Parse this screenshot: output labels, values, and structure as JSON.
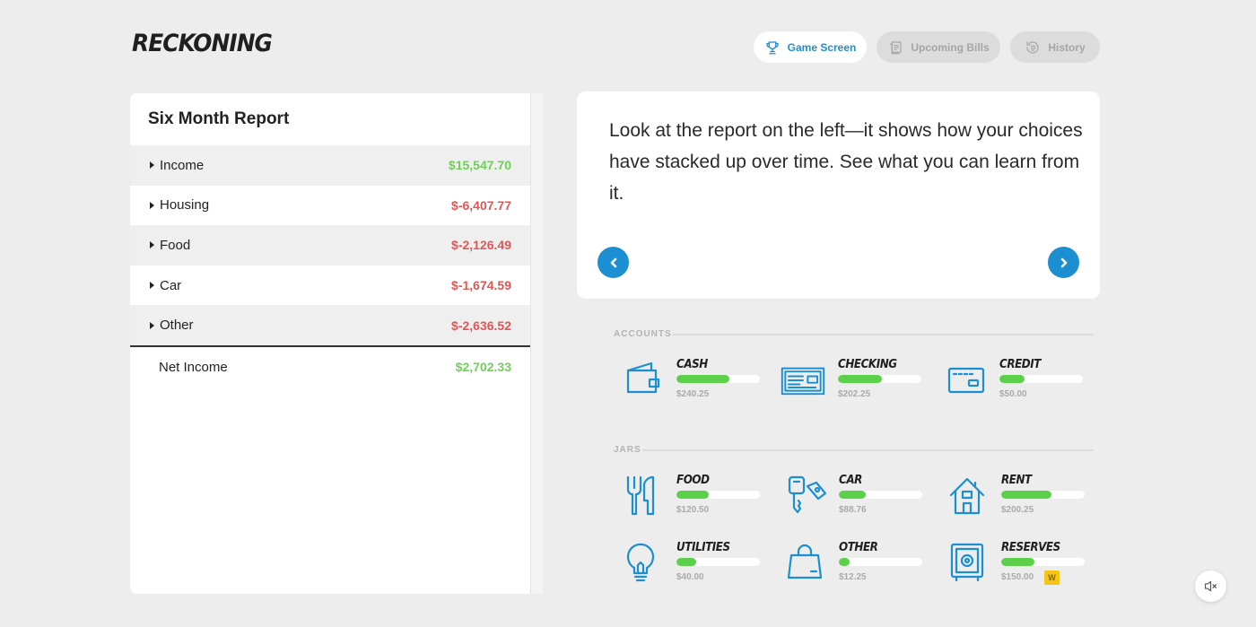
{
  "app": {
    "logo": "RECKONING"
  },
  "nav": [
    {
      "label": "Game Screen",
      "icon": "trophy-icon",
      "active": true
    },
    {
      "label": "Upcoming Bills",
      "icon": "bills-icon",
      "active": false
    },
    {
      "label": "History",
      "icon": "history-icon",
      "active": false
    }
  ],
  "report": {
    "title": "Six Month Report",
    "rows": [
      {
        "label": "Income",
        "amount": "$15,547.70",
        "status": "positive"
      },
      {
        "label": "Housing",
        "amount": "$-6,407.77",
        "status": "negative"
      },
      {
        "label": "Food",
        "amount": "$-2,126.49",
        "status": "negative"
      },
      {
        "label": "Car",
        "amount": "$-1,674.59",
        "status": "negative"
      },
      {
        "label": "Other",
        "amount": "$-2,636.52",
        "status": "negative"
      }
    ],
    "net": {
      "label": "Net Income",
      "amount": "$2,702.33"
    }
  },
  "message": {
    "text": "Look at the report on the left—it shows how your choices have stacked up over time. See what you can learn from it."
  },
  "accounts": {
    "label": "ACCOUNTS",
    "items": [
      {
        "name": "CASH",
        "value": "$240.25",
        "fill_fraction": 0.63,
        "icon": "wallet-icon"
      },
      {
        "name": "CHECKING",
        "value": "$202.25",
        "fill_fraction": 0.53,
        "icon": "check-icon"
      },
      {
        "name": "CREDIT",
        "value": "$50.00",
        "fill_fraction": 0.3,
        "icon": "credit-card-icon"
      }
    ]
  },
  "jars": {
    "label": "JARS",
    "items": [
      {
        "name": "FOOD",
        "value": "$120.50",
        "fill_fraction": 0.39,
        "icon": "fork-knife-icon"
      },
      {
        "name": "CAR",
        "value": "$88.76",
        "fill_fraction": 0.32,
        "icon": "car-key-icon"
      },
      {
        "name": "RENT",
        "value": "$200.25",
        "fill_fraction": 0.6,
        "icon": "house-icon"
      },
      {
        "name": "UTILITIES",
        "value": "$40.00",
        "fill_fraction": 0.24,
        "icon": "lightbulb-icon"
      },
      {
        "name": "OTHER",
        "value": "$12.25",
        "fill_fraction": 0.13,
        "icon": "shopping-bag-icon"
      },
      {
        "name": "RESERVES",
        "value": "$150.00",
        "fill_fraction": 0.4,
        "icon": "safe-icon",
        "badge": "W"
      }
    ]
  },
  "colors": {
    "accent": "#1c8fd2",
    "positive": "#6fcf57",
    "negative": "#e05656",
    "bar": "#5cd04a"
  }
}
